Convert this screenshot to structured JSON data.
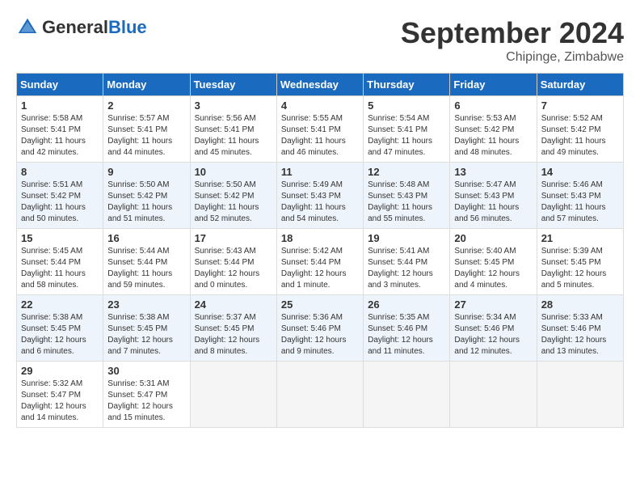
{
  "header": {
    "logo_general": "General",
    "logo_blue": "Blue",
    "month_title": "September 2024",
    "location": "Chipinge, Zimbabwe"
  },
  "days_of_week": [
    "Sunday",
    "Monday",
    "Tuesday",
    "Wednesday",
    "Thursday",
    "Friday",
    "Saturday"
  ],
  "weeks": [
    [
      {
        "day": "1",
        "info": "Sunrise: 5:58 AM\nSunset: 5:41 PM\nDaylight: 11 hours\nand 42 minutes."
      },
      {
        "day": "2",
        "info": "Sunrise: 5:57 AM\nSunset: 5:41 PM\nDaylight: 11 hours\nand 44 minutes."
      },
      {
        "day": "3",
        "info": "Sunrise: 5:56 AM\nSunset: 5:41 PM\nDaylight: 11 hours\nand 45 minutes."
      },
      {
        "day": "4",
        "info": "Sunrise: 5:55 AM\nSunset: 5:41 PM\nDaylight: 11 hours\nand 46 minutes."
      },
      {
        "day": "5",
        "info": "Sunrise: 5:54 AM\nSunset: 5:41 PM\nDaylight: 11 hours\nand 47 minutes."
      },
      {
        "day": "6",
        "info": "Sunrise: 5:53 AM\nSunset: 5:42 PM\nDaylight: 11 hours\nand 48 minutes."
      },
      {
        "day": "7",
        "info": "Sunrise: 5:52 AM\nSunset: 5:42 PM\nDaylight: 11 hours\nand 49 minutes."
      }
    ],
    [
      {
        "day": "8",
        "info": "Sunrise: 5:51 AM\nSunset: 5:42 PM\nDaylight: 11 hours\nand 50 minutes."
      },
      {
        "day": "9",
        "info": "Sunrise: 5:50 AM\nSunset: 5:42 PM\nDaylight: 11 hours\nand 51 minutes."
      },
      {
        "day": "10",
        "info": "Sunrise: 5:50 AM\nSunset: 5:42 PM\nDaylight: 11 hours\nand 52 minutes."
      },
      {
        "day": "11",
        "info": "Sunrise: 5:49 AM\nSunset: 5:43 PM\nDaylight: 11 hours\nand 54 minutes."
      },
      {
        "day": "12",
        "info": "Sunrise: 5:48 AM\nSunset: 5:43 PM\nDaylight: 11 hours\nand 55 minutes."
      },
      {
        "day": "13",
        "info": "Sunrise: 5:47 AM\nSunset: 5:43 PM\nDaylight: 11 hours\nand 56 minutes."
      },
      {
        "day": "14",
        "info": "Sunrise: 5:46 AM\nSunset: 5:43 PM\nDaylight: 11 hours\nand 57 minutes."
      }
    ],
    [
      {
        "day": "15",
        "info": "Sunrise: 5:45 AM\nSunset: 5:44 PM\nDaylight: 11 hours\nand 58 minutes."
      },
      {
        "day": "16",
        "info": "Sunrise: 5:44 AM\nSunset: 5:44 PM\nDaylight: 11 hours\nand 59 minutes."
      },
      {
        "day": "17",
        "info": "Sunrise: 5:43 AM\nSunset: 5:44 PM\nDaylight: 12 hours\nand 0 minutes."
      },
      {
        "day": "18",
        "info": "Sunrise: 5:42 AM\nSunset: 5:44 PM\nDaylight: 12 hours\nand 1 minute."
      },
      {
        "day": "19",
        "info": "Sunrise: 5:41 AM\nSunset: 5:44 PM\nDaylight: 12 hours\nand 3 minutes."
      },
      {
        "day": "20",
        "info": "Sunrise: 5:40 AM\nSunset: 5:45 PM\nDaylight: 12 hours\nand 4 minutes."
      },
      {
        "day": "21",
        "info": "Sunrise: 5:39 AM\nSunset: 5:45 PM\nDaylight: 12 hours\nand 5 minutes."
      }
    ],
    [
      {
        "day": "22",
        "info": "Sunrise: 5:38 AM\nSunset: 5:45 PM\nDaylight: 12 hours\nand 6 minutes."
      },
      {
        "day": "23",
        "info": "Sunrise: 5:38 AM\nSunset: 5:45 PM\nDaylight: 12 hours\nand 7 minutes."
      },
      {
        "day": "24",
        "info": "Sunrise: 5:37 AM\nSunset: 5:45 PM\nDaylight: 12 hours\nand 8 minutes."
      },
      {
        "day": "25",
        "info": "Sunrise: 5:36 AM\nSunset: 5:46 PM\nDaylight: 12 hours\nand 9 minutes."
      },
      {
        "day": "26",
        "info": "Sunrise: 5:35 AM\nSunset: 5:46 PM\nDaylight: 12 hours\nand 11 minutes."
      },
      {
        "day": "27",
        "info": "Sunrise: 5:34 AM\nSunset: 5:46 PM\nDaylight: 12 hours\nand 12 minutes."
      },
      {
        "day": "28",
        "info": "Sunrise: 5:33 AM\nSunset: 5:46 PM\nDaylight: 12 hours\nand 13 minutes."
      }
    ],
    [
      {
        "day": "29",
        "info": "Sunrise: 5:32 AM\nSunset: 5:47 PM\nDaylight: 12 hours\nand 14 minutes."
      },
      {
        "day": "30",
        "info": "Sunrise: 5:31 AM\nSunset: 5:47 PM\nDaylight: 12 hours\nand 15 minutes."
      },
      {
        "day": "",
        "info": ""
      },
      {
        "day": "",
        "info": ""
      },
      {
        "day": "",
        "info": ""
      },
      {
        "day": "",
        "info": ""
      },
      {
        "day": "",
        "info": ""
      }
    ]
  ]
}
